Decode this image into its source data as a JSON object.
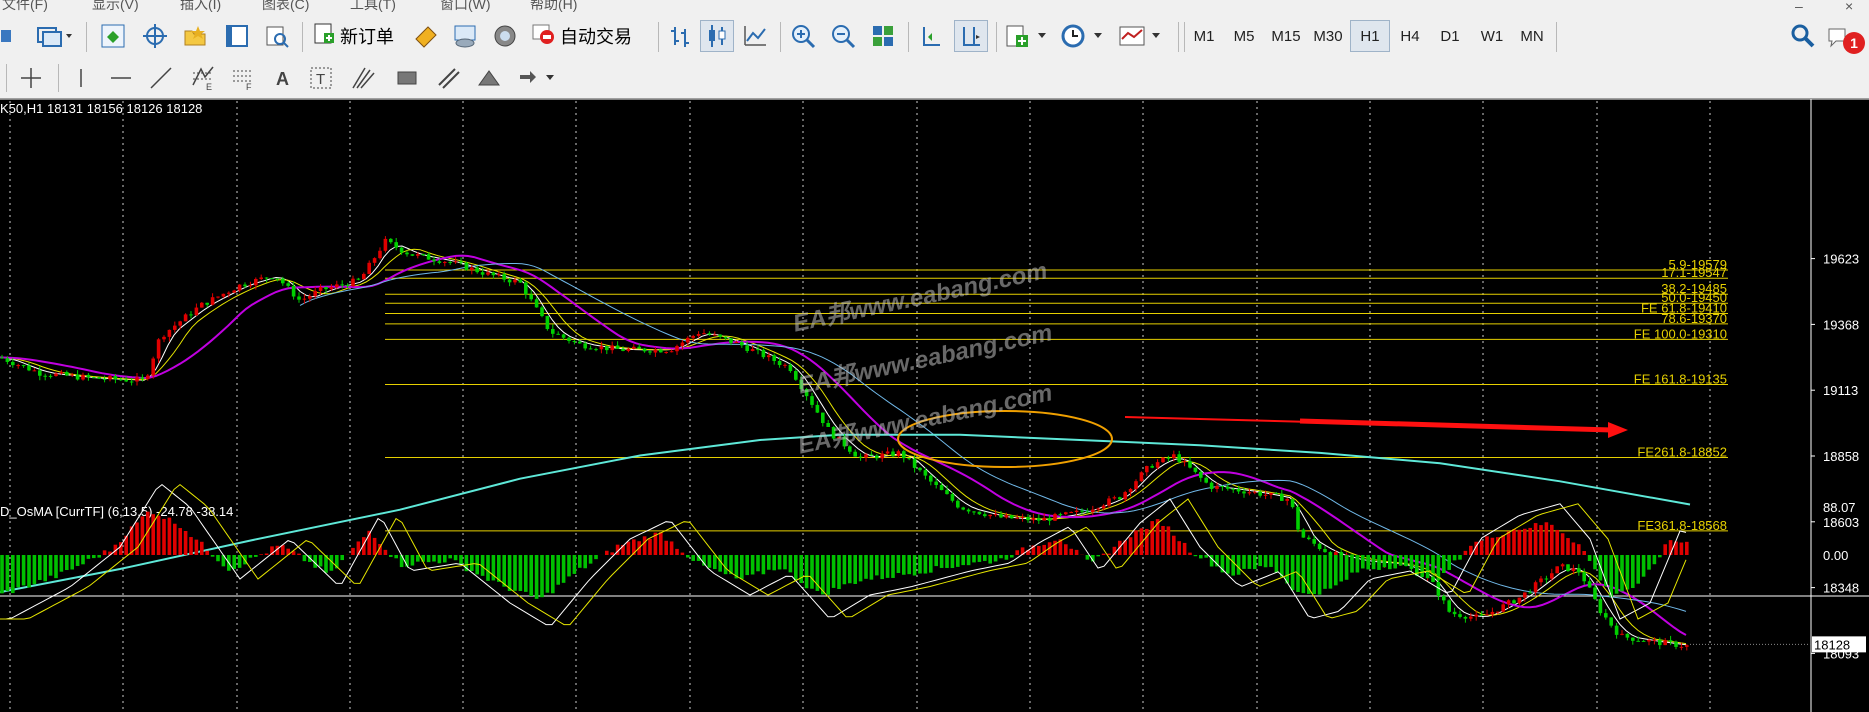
{
  "menu": {
    "items": [
      "文件(F)",
      "显示(V)",
      "插入(I)",
      "图表(C)",
      "工具(T)",
      "窗口(W)",
      "帮助(H)"
    ]
  },
  "toolbar": {
    "new_order_label": "新订单",
    "auto_trade_label": "自动交易",
    "timeframes": [
      "M1",
      "M5",
      "M15",
      "M30",
      "H1",
      "H4",
      "D1",
      "W1",
      "MN"
    ],
    "active_timeframe": "H1",
    "notification_count": "1"
  },
  "icons": {
    "toolbar1": [
      "new-chart-icon",
      "profiles-icon",
      "market-watch-icon",
      "data-window-icon",
      "navigator-icon",
      "terminal-icon",
      "strategy-tester-icon",
      "new-order-icon",
      "metaeditor-icon",
      "signals-icon",
      "market-icon",
      "auto-trading-icon",
      "bar-chart-icon",
      "candlesticks-icon",
      "line-chart-icon",
      "zoom-in-icon",
      "zoom-out-icon",
      "tile-windows-icon",
      "autoscroll-icon",
      "chart-shift-icon",
      "indicators-icon",
      "periods-icon",
      "templates-icon",
      "search-icon",
      "notifications-icon"
    ],
    "toolbar2": [
      "crosshair-icon",
      "vertical-line-icon",
      "horizontal-line-icon",
      "trendline-icon",
      "fibonacci-expansion-icon",
      "fibonacci-fan-icon",
      "text-icon",
      "text-label-icon",
      "pitchfork-icon",
      "rectangle-icon",
      "channel-icon",
      "triangle-icon",
      "arrows-icon"
    ]
  },
  "chart": {
    "info": "K50,H1  18131 18156 18126 18128",
    "price_axis": [
      "19623",
      "19368",
      "19113",
      "18858",
      "18603",
      "18348",
      "18093"
    ],
    "current_price": "18128",
    "fib_levels": [
      {
        "label": "5.9-19579",
        "price": 19579
      },
      {
        "label": "17.1-19547",
        "price": 19547
      },
      {
        "label": "38.2-19485",
        "price": 19485
      },
      {
        "label": "50.0-19450",
        "price": 19450
      },
      {
        "label": "FE 61.8-19410",
        "price": 19410
      },
      {
        "label": "78.6-19370",
        "price": 19370
      },
      {
        "label": "FE 100.0-19310",
        "price": 19310
      },
      {
        "label": "FE 161.8-19135",
        "price": 19135
      },
      {
        "label": "FE261.8-18852",
        "price": 18852
      },
      {
        "label": "FE361.8-18568",
        "price": 18568
      }
    ],
    "fib_color": "#e6d000",
    "ema_colors": {
      "white": "#ffffff",
      "yellow": "#e6e600",
      "magenta": "#c000e0",
      "lightblue": "#70b8e8",
      "aqua": "#5ee8d8"
    },
    "annotation_color": "#f0a000",
    "arrow_color": "#ff1010",
    "watermarks": [
      "EA邦www.eabang.com",
      "EA邦www.eabang.com",
      "EA邦www.eabang.com"
    ]
  },
  "indicator": {
    "label": "D_OsMA [CurrTF] (6,13,5) -24.78 -38.14",
    "axis": [
      "88.07",
      "0.00"
    ],
    "up_color": "#e00000",
    "down_color": "#00c000"
  }
}
